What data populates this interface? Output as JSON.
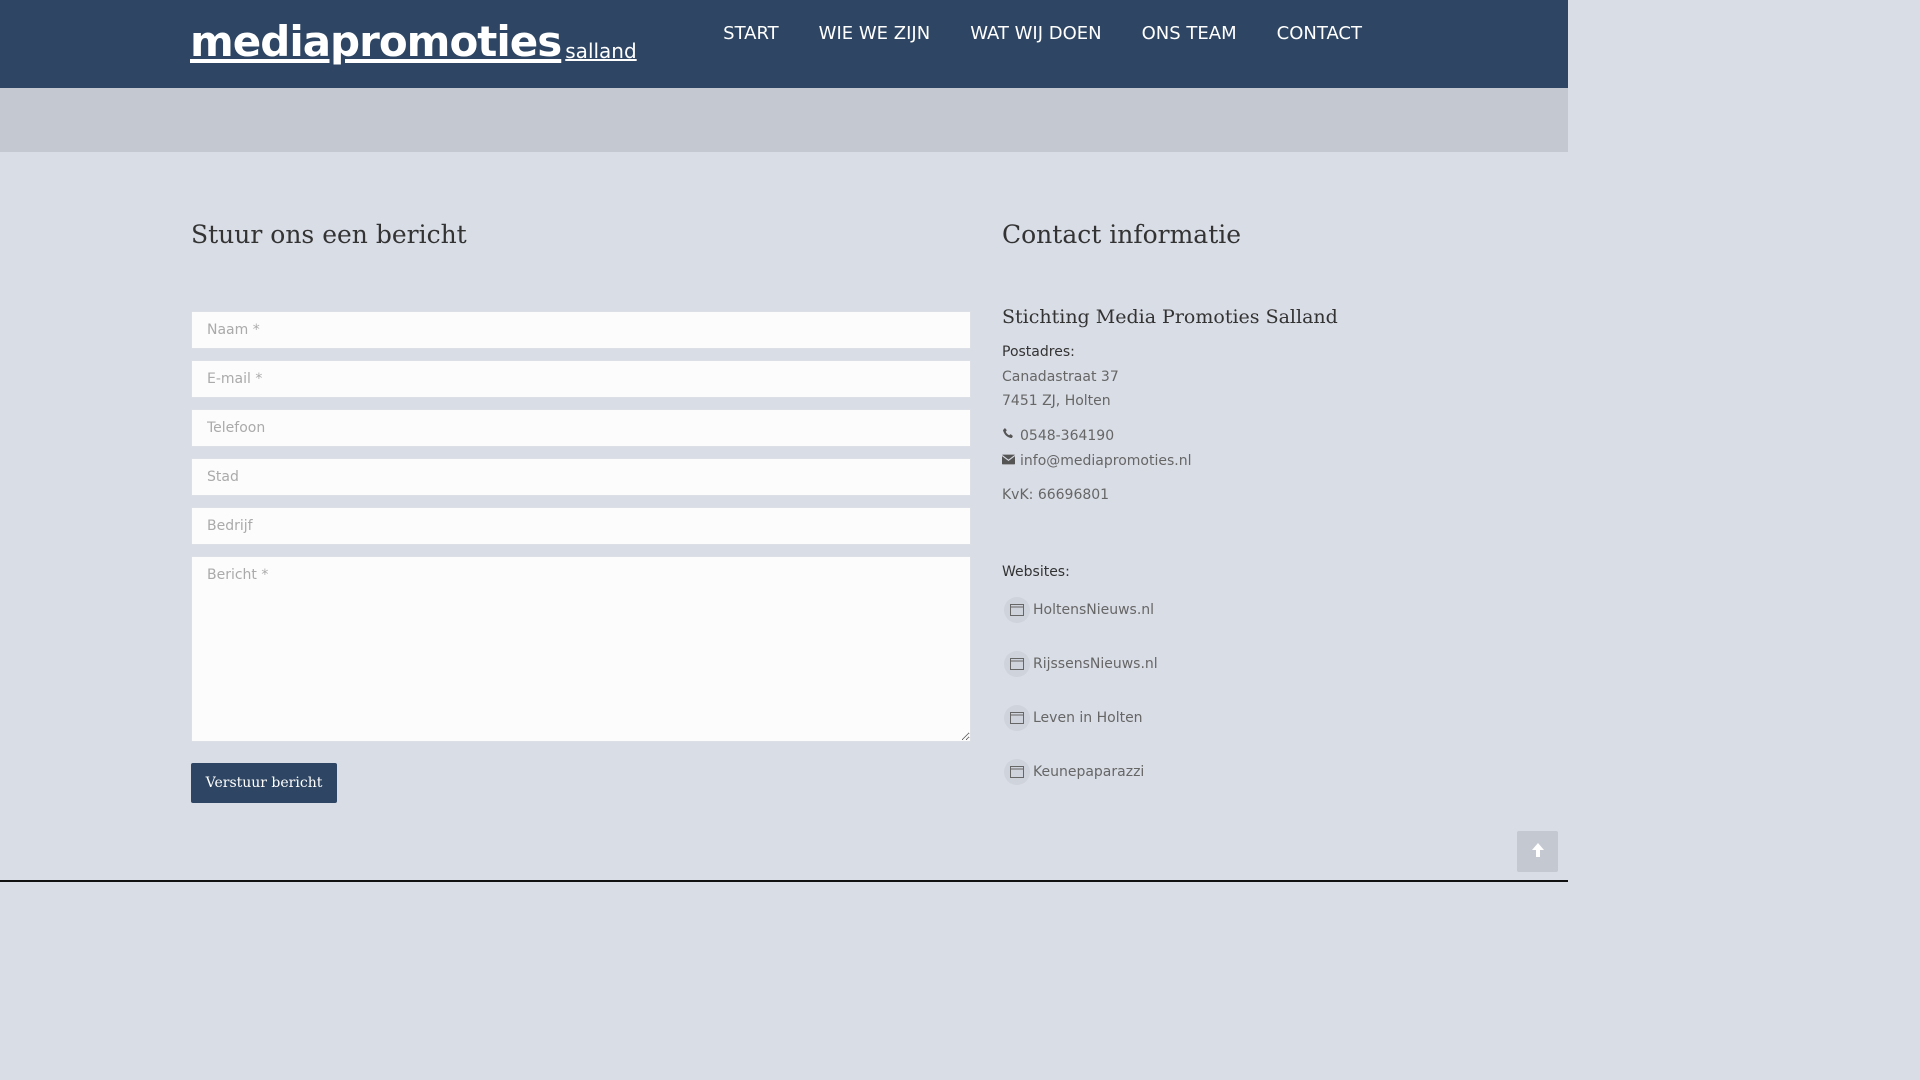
{
  "logo": {
    "main": "mediapromoties",
    "sub": "salland"
  },
  "nav": {
    "items": [
      {
        "label": "START"
      },
      {
        "label": "WIE WE ZIJN"
      },
      {
        "label": "WAT WIJ DOEN"
      },
      {
        "label": "ONS TEAM"
      },
      {
        "label": "CONTACT"
      }
    ]
  },
  "form": {
    "title": "Stuur ons een bericht",
    "fields": {
      "name": {
        "placeholder": "Naam *",
        "value": ""
      },
      "email": {
        "placeholder": "E-mail *",
        "value": ""
      },
      "phone": {
        "placeholder": "Telefoon",
        "value": ""
      },
      "city": {
        "placeholder": "Stad",
        "value": ""
      },
      "company": {
        "placeholder": "Bedrijf",
        "value": ""
      },
      "message": {
        "placeholder": "Bericht *",
        "value": ""
      }
    },
    "submit_label": "Verstuur bericht"
  },
  "contact": {
    "title": "Contact informatie",
    "organization": "Stichting Media Promoties Salland",
    "postal_label": "Postadres:",
    "street": "Canadastraat 37",
    "city_line": "7451 ZJ, Holten",
    "phone": "0548-364190",
    "email": "info@mediapromoties.nl",
    "kvk": "KvK: 66696801",
    "websites_label": "Websites:",
    "websites": [
      {
        "label": "HoltensNieuws.nl",
        "icon": "browser-window-icon"
      },
      {
        "label": "RijssensNieuws.nl",
        "icon": "browser-window-icon"
      },
      {
        "label": "Leven in Holten",
        "icon": "browser-window-icon"
      },
      {
        "label": "Keunepaparazzi",
        "icon": "browser-window-icon"
      }
    ]
  },
  "icons": {
    "phone": "phone-icon",
    "email": "envelope-icon",
    "scroll_top": "arrow-up-icon"
  },
  "colors": {
    "header_bg": "#2e4663",
    "page_bg": "#d9dde6",
    "strip_bg": "#c3c8d1",
    "button_bg": "#2e4663"
  }
}
